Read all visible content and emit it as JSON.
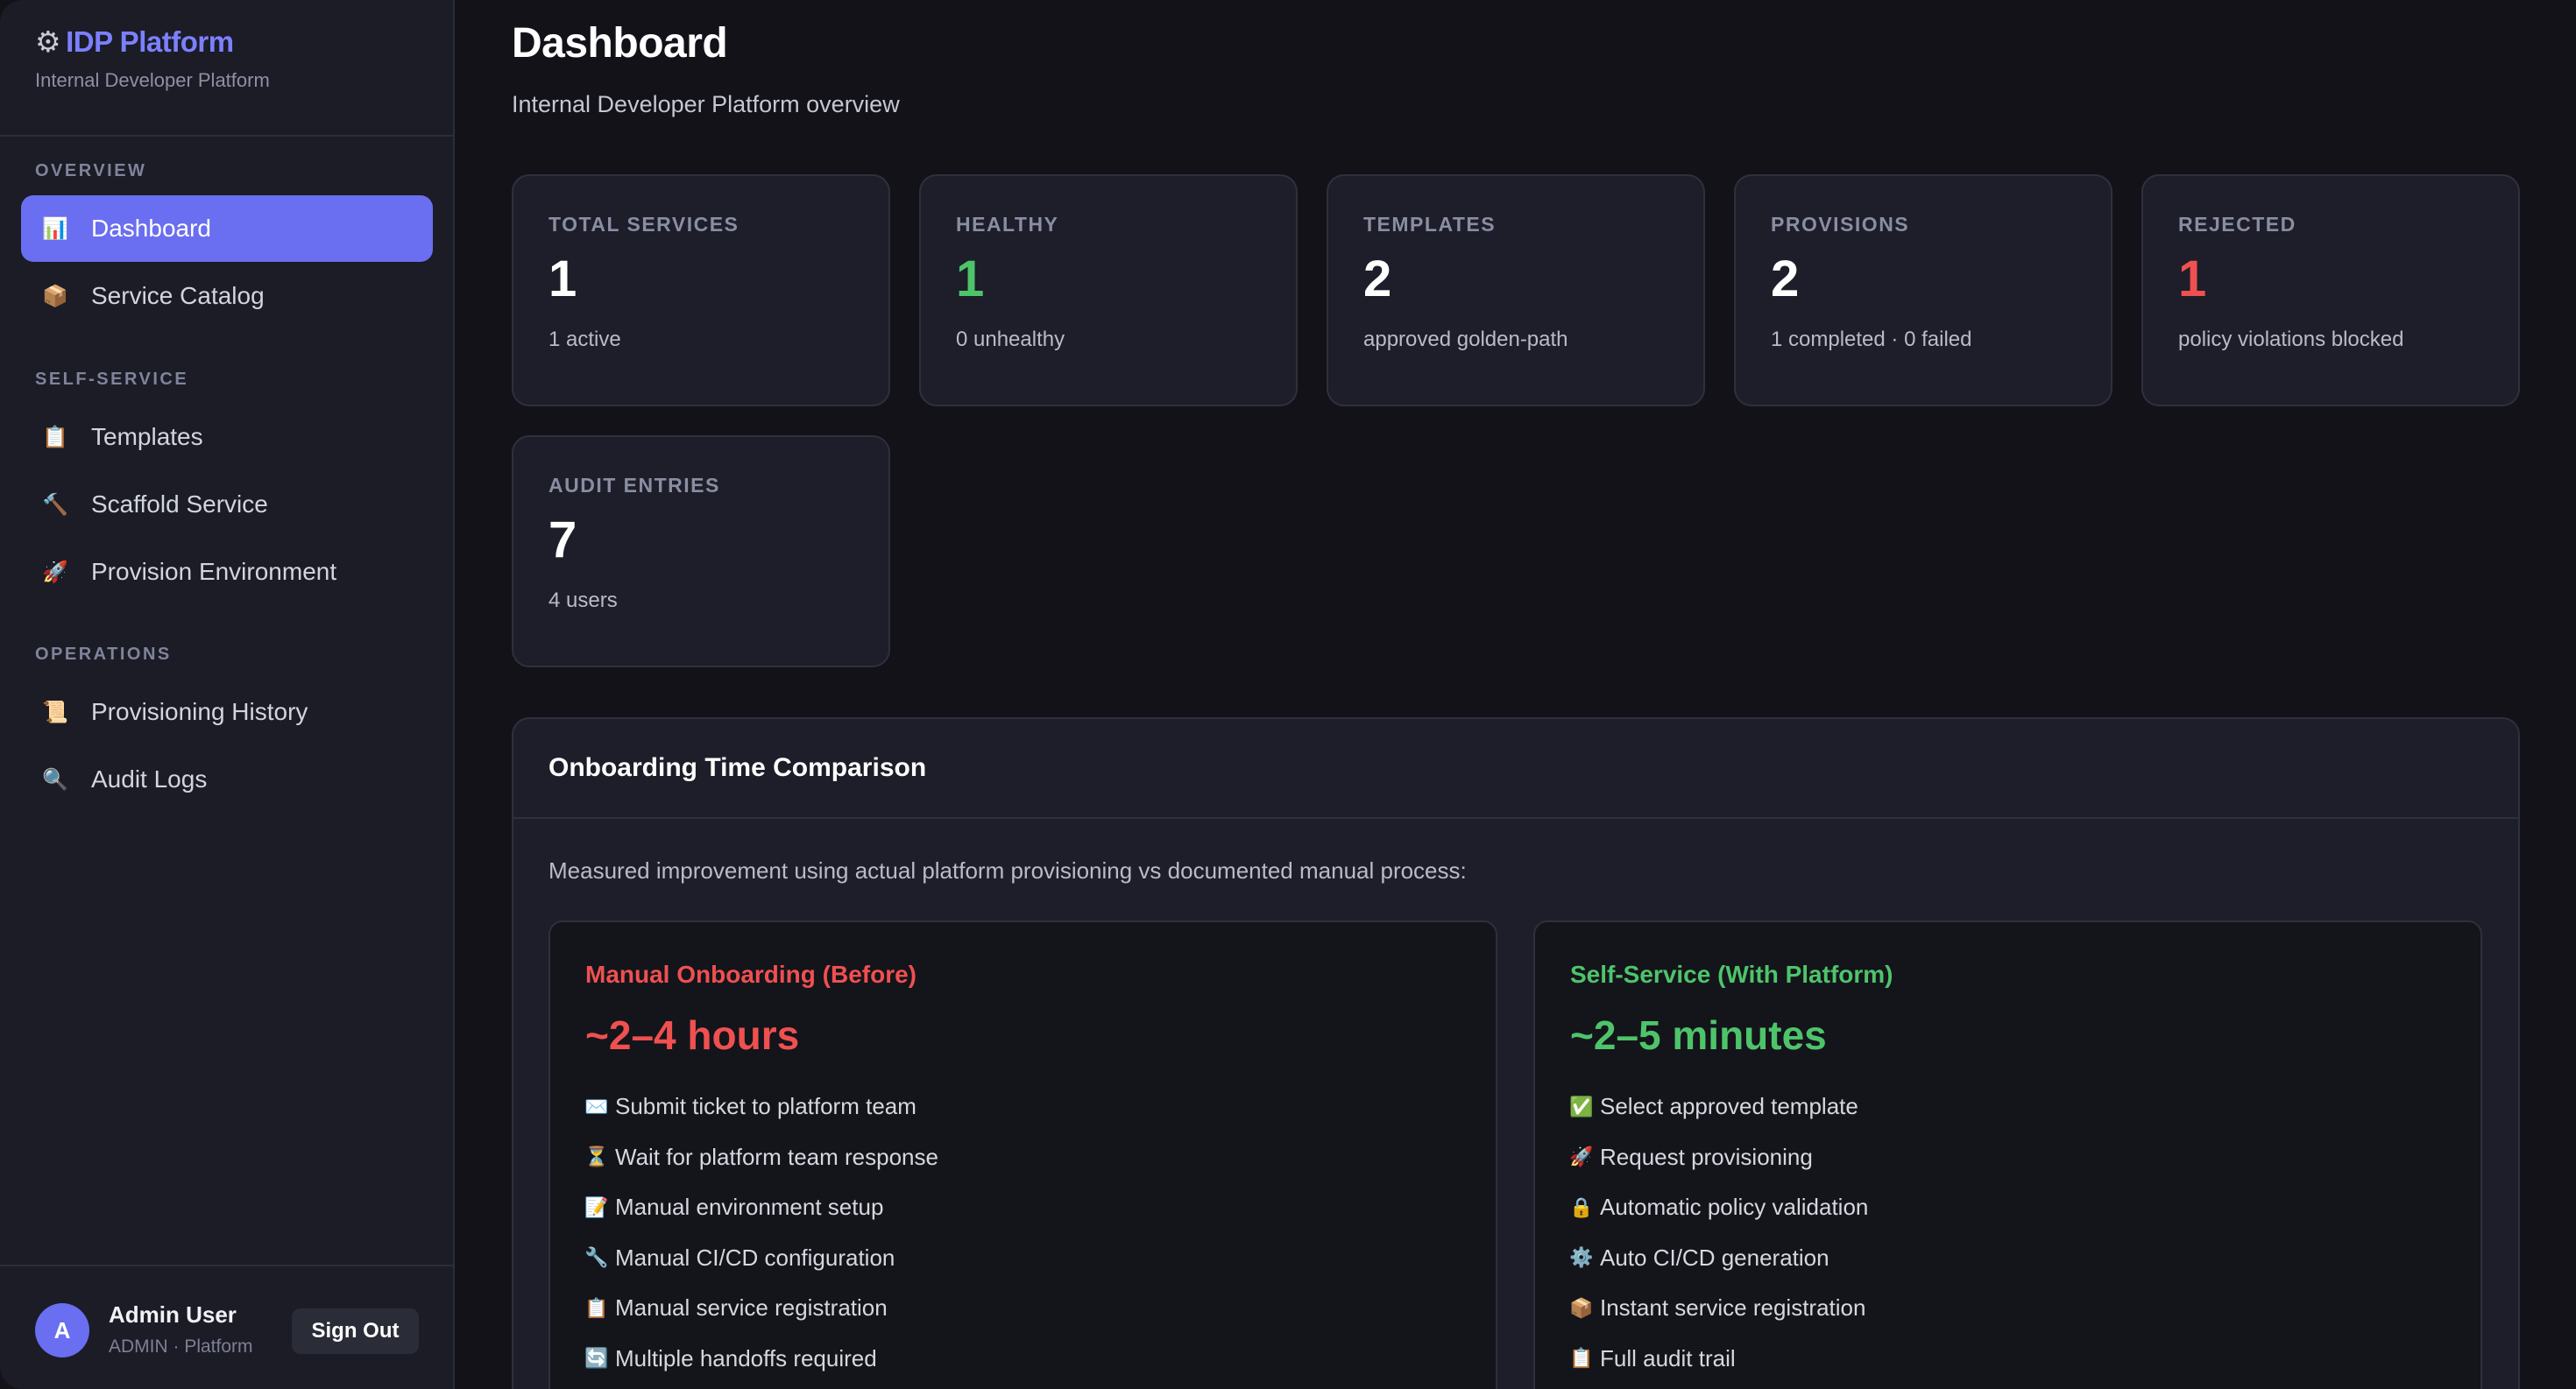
{
  "brand": {
    "icon": "gear-icon",
    "title": "IDP Platform",
    "subtitle": "Internal Developer Platform"
  },
  "sidebar": {
    "sections": [
      {
        "label": "OVERVIEW"
      },
      {
        "label": "SELF-SERVICE"
      },
      {
        "label": "OPERATIONS"
      }
    ],
    "items": [
      {
        "label": "Dashboard",
        "icon": "bar-chart-icon",
        "glyph": "📊",
        "active": true
      },
      {
        "label": "Service Catalog",
        "icon": "package-icon",
        "glyph": "📦"
      },
      {
        "label": "Templates",
        "icon": "clipboard-icon",
        "glyph": "📋"
      },
      {
        "label": "Scaffold Service",
        "icon": "hammer-icon",
        "glyph": "🔨"
      },
      {
        "label": "Provision Environment",
        "icon": "rocket-icon",
        "glyph": "🚀"
      },
      {
        "label": "Provisioning History",
        "icon": "scroll-icon",
        "glyph": "📜"
      },
      {
        "label": "Audit Logs",
        "icon": "magnifier-icon",
        "glyph": "🔍"
      }
    ]
  },
  "user": {
    "initial": "A",
    "name": "Admin User",
    "role": "ADMIN · Platform",
    "signout_label": "Sign Out"
  },
  "header": {
    "title": "Dashboard",
    "subtitle": "Internal Developer Platform overview"
  },
  "stats": [
    {
      "label": "TOTAL SERVICES",
      "value": "1",
      "foot": "1 active",
      "color": "#ffffff"
    },
    {
      "label": "HEALTHY",
      "value": "1",
      "foot": "0 unhealthy",
      "color": "#4ec46a"
    },
    {
      "label": "TEMPLATES",
      "value": "2",
      "foot": "approved golden-path",
      "color": "#ffffff"
    },
    {
      "label": "PROVISIONS",
      "value": "2",
      "foot": "1 completed · 0 failed",
      "color": "#ffffff"
    },
    {
      "label": "REJECTED",
      "value": "1",
      "foot": "policy violations blocked",
      "color": "#ef5050"
    },
    {
      "label": "AUDIT ENTRIES",
      "value": "7",
      "foot": "4 users",
      "color": "#ffffff"
    }
  ],
  "comparison": {
    "title": "Onboarding Time Comparison",
    "description": "Measured improvement using actual platform provisioning vs documented manual process:",
    "manual": {
      "title": "Manual Onboarding (Before)",
      "time": "~2–4 hours",
      "color": "#ef5050",
      "items": [
        {
          "glyph": "✉️",
          "icon": "envelope-icon",
          "text": "Submit ticket to platform team"
        },
        {
          "glyph": "⏳",
          "icon": "hourglass-icon",
          "text": "Wait for platform team response"
        },
        {
          "glyph": "📝",
          "icon": "memo-icon",
          "text": "Manual environment setup"
        },
        {
          "glyph": "🔧",
          "icon": "wrench-icon",
          "text": "Manual CI/CD configuration"
        },
        {
          "glyph": "📋",
          "icon": "clipboard-icon",
          "text": "Manual service registration"
        },
        {
          "glyph": "🔄",
          "icon": "cycle-icon",
          "text": "Multiple handoffs required"
        }
      ]
    },
    "self_service": {
      "title": "Self-Service (With Platform)",
      "time": "~2–5 minutes",
      "color": "#4ec46a",
      "items": [
        {
          "glyph": "✅",
          "icon": "check-icon",
          "text": "Select approved template"
        },
        {
          "glyph": "🚀",
          "icon": "rocket-icon",
          "text": "Request provisioning"
        },
        {
          "glyph": "🔒",
          "icon": "lock-icon",
          "text": "Automatic policy validation"
        },
        {
          "glyph": "⚙️",
          "icon": "gear-icon",
          "text": "Auto CI/CD generation"
        },
        {
          "glyph": "📦",
          "icon": "package-icon",
          "text": "Instant service registration"
        },
        {
          "glyph": "📋",
          "icon": "clipboard-icon",
          "text": "Full audit trail"
        }
      ]
    }
  }
}
